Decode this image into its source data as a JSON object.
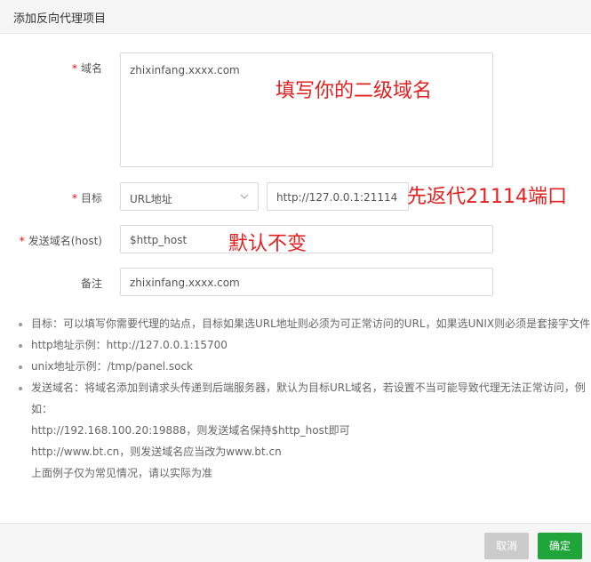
{
  "dialog": {
    "title": "添加反向代理项目"
  },
  "form": {
    "domain": {
      "label": "域名",
      "value": "zhixinfang.xxxx.com"
    },
    "target": {
      "label": "目标",
      "select_value": "URL地址",
      "url_value": "http://127.0.0.1:21114"
    },
    "send_domain": {
      "label": "发送域名(host)",
      "value": "$http_host"
    },
    "remark": {
      "label": "备注",
      "value": "zhixinfang.xxxx.com"
    },
    "required_mark": "*"
  },
  "annotations": {
    "domain_note": "填写你的二级域名",
    "target_note": "先返代21114端口",
    "host_note": "默认不变"
  },
  "tips": {
    "target": "目标：可以填写你需要代理的站点，目标如果选URL地址则必须为可正常访问的URL，如果选UNIX则必须是套接字文件",
    "http_example": "http地址示例：http://127.0.0.1:15700",
    "unix_example": "unix地址示例：/tmp/panel.sock",
    "send_domain_1": "发送域名：将域名添加到请求头传递到后端服务器，默认为目标URL域名，若设置不当可能导致代理无法正常访问，例如：",
    "send_domain_2": "http://192.168.100.20:19888，则发送域名保持$http_host即可",
    "send_domain_3": "http://www.bt.cn，则发送域名应当改为www.bt.cn",
    "send_domain_4": "上面例子仅为常见情况，请以实际为准"
  },
  "footer": {
    "cancel_label": "取消",
    "confirm_label": "确定"
  },
  "colors": {
    "accent": "#20a53a",
    "required": "#ef0808",
    "note": "#e4201f",
    "disabled": "#cbcbcb"
  }
}
